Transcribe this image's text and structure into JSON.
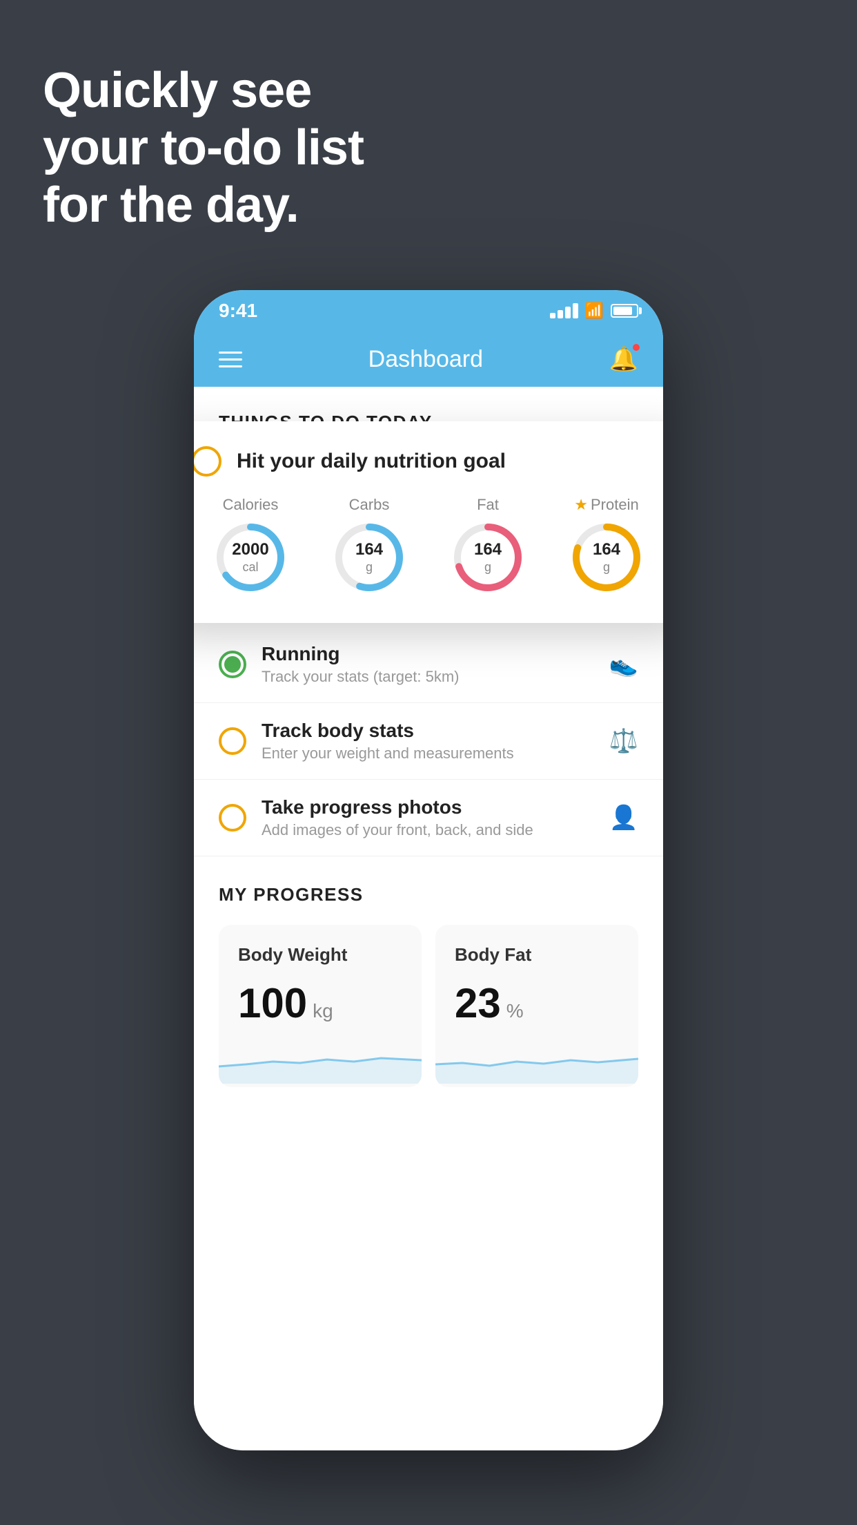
{
  "background": {
    "color": "#3a3f47"
  },
  "hero": {
    "line1": "Quickly see",
    "line2": "your to-do list",
    "line3": "for the day."
  },
  "status_bar": {
    "time": "9:41",
    "color": "#57b8e8"
  },
  "app_header": {
    "title": "Dashboard",
    "color": "#57b8e8"
  },
  "section_today": {
    "label": "THINGS TO DO TODAY"
  },
  "nutrition_card": {
    "title": "Hit your daily nutrition goal",
    "items": [
      {
        "label": "Calories",
        "value": "2000",
        "unit": "cal",
        "color": "#57b8e8",
        "percent": 65
      },
      {
        "label": "Carbs",
        "value": "164",
        "unit": "g",
        "color": "#57b8e8",
        "percent": 55
      },
      {
        "label": "Fat",
        "value": "164",
        "unit": "g",
        "color": "#e95e7a",
        "percent": 70
      },
      {
        "label": "Protein",
        "value": "164",
        "unit": "g",
        "color": "#f0a500",
        "percent": 80,
        "starred": true
      }
    ]
  },
  "todo_items": [
    {
      "title": "Running",
      "subtitle": "Track your stats (target: 5km)",
      "status": "done",
      "icon": "shoe"
    },
    {
      "title": "Track body stats",
      "subtitle": "Enter your weight and measurements",
      "status": "pending",
      "icon": "scale"
    },
    {
      "title": "Take progress photos",
      "subtitle": "Add images of your front, back, and side",
      "status": "pending",
      "icon": "person"
    }
  ],
  "progress_section": {
    "label": "MY PROGRESS",
    "cards": [
      {
        "title": "Body Weight",
        "value": "100",
        "unit": "kg"
      },
      {
        "title": "Body Fat",
        "value": "23",
        "unit": "%"
      }
    ]
  }
}
